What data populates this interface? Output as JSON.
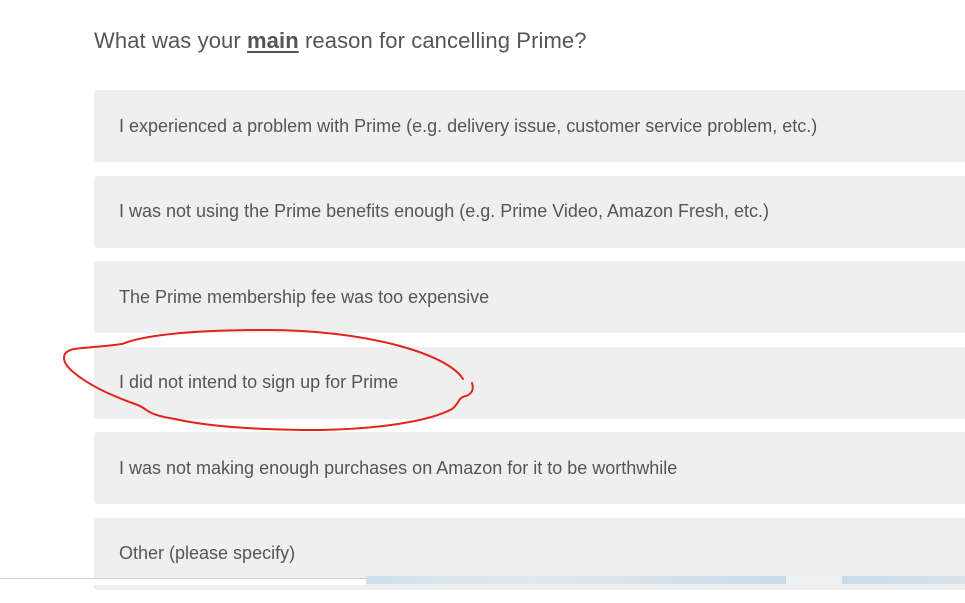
{
  "survey": {
    "question": {
      "prefix": "What was your ",
      "emphasis": "main",
      "suffix": " reason for cancelling Prime?"
    },
    "options": [
      {
        "label": "I experienced a problem with Prime (e.g. delivery issue, customer service problem, etc.)"
      },
      {
        "label": "I was not using the Prime benefits enough (e.g. Prime Video, Amazon Fresh, etc.)"
      },
      {
        "label": "The Prime membership fee was too expensive"
      },
      {
        "label": "I did not intend to sign up for Prime"
      },
      {
        "label": "I was not making enough purchases on Amazon for it to be worthwhile"
      },
      {
        "label": "Other (please specify)"
      }
    ]
  },
  "annotation": {
    "color": "#e2241b",
    "circled_option": "I did not intend to sign up for Prime"
  }
}
